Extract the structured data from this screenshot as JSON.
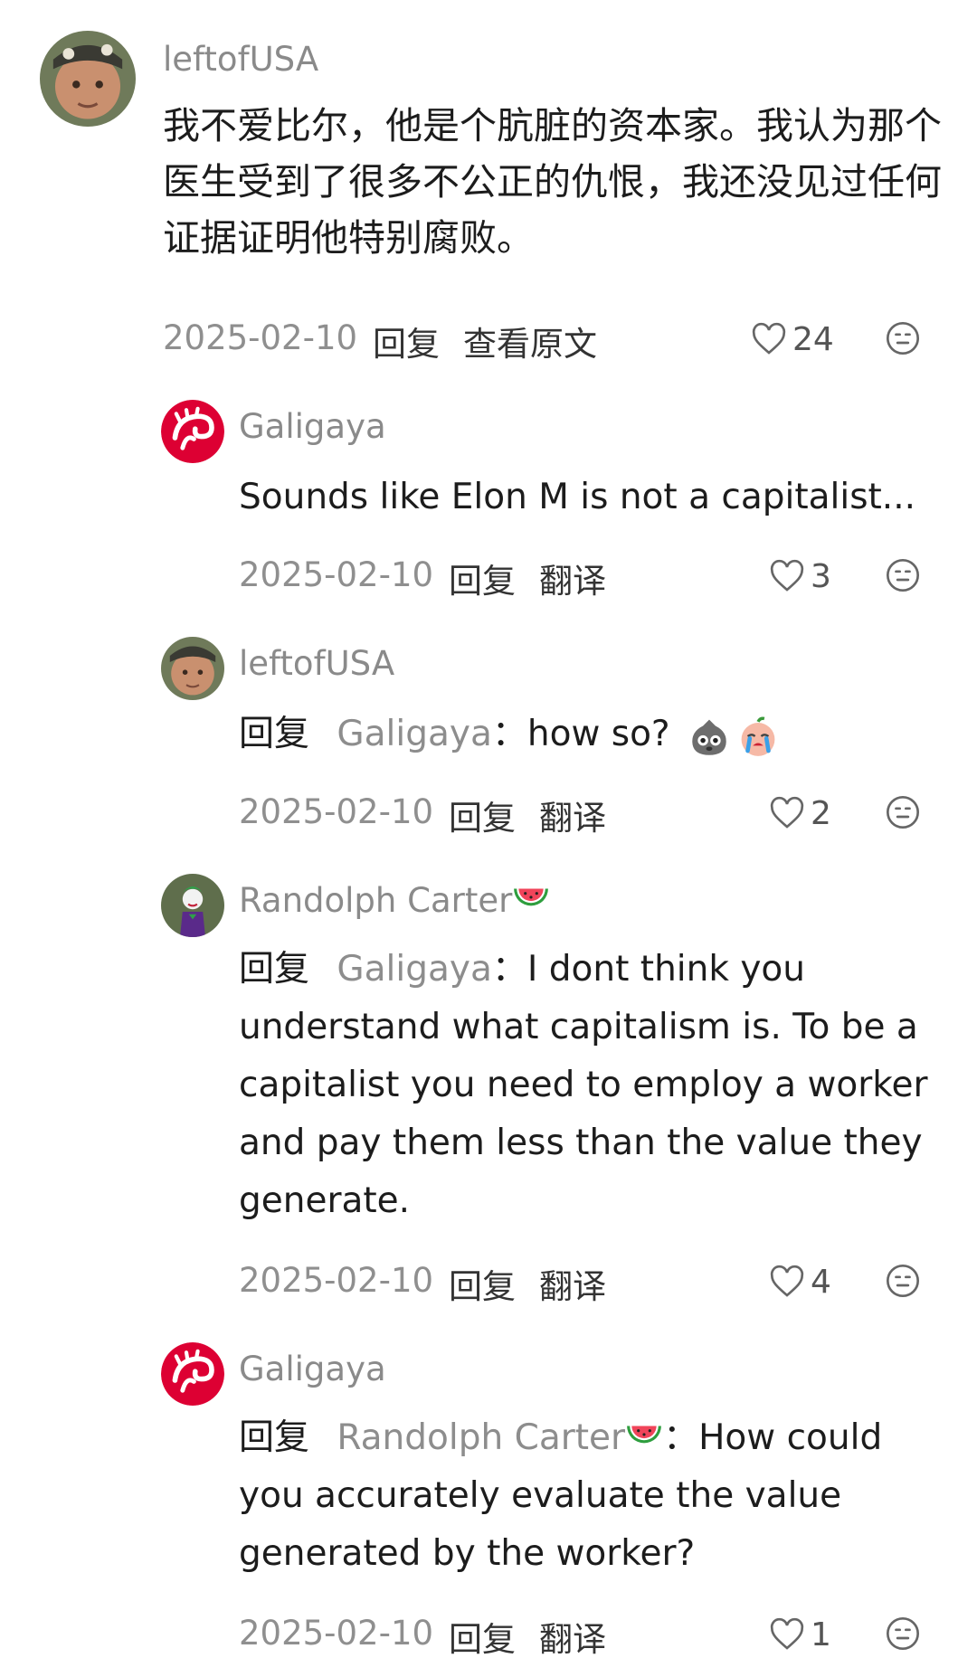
{
  "comments": [
    {
      "username": "leftofUSA",
      "text": "我不爱比尔，他是个肮脏的资本家。我认为那个医生受到了很多不公正的仇恨，我还没见过任何证据证明他特别腐败。",
      "lines": [
        "我不爱比尔，他是个肮脏的资本家。我认为那个",
        "医生受到了很多不公正的仇恨，我还没见过任何",
        "证据证明他特别腐败。"
      ],
      "date": "2025-02-10",
      "reply_label": "回复",
      "secondary_label": "查看原文",
      "likes": "24",
      "avatar_icon": "user-avatar-photo",
      "emoji_icon": "neutral-face-icon"
    },
    {
      "username": "Galigaya",
      "text": "Sounds like Elon M is not a capitalist...",
      "date": "2025-02-10",
      "reply_label": "回复",
      "secondary_label": "翻译",
      "likes": "3",
      "avatar_icon": "red-swirl-logo-avatar",
      "emoji_icon": "neutral-face-icon"
    },
    {
      "username": "leftofUSA",
      "reply_prefix": "回复",
      "reply_to": "Galigaya",
      "separator": "：",
      "text": "how so?",
      "inline_emojis": [
        "grey-sack-face-emoji",
        "crying-peach-face-emoji"
      ],
      "date": "2025-02-10",
      "reply_label": "回复",
      "secondary_label": "翻译",
      "likes": "2",
      "avatar_icon": "user-avatar-photo",
      "emoji_icon": "neutral-face-icon"
    },
    {
      "username": "Randolph Carter",
      "username_emoji": "watermelon-emoji",
      "reply_prefix": "回复",
      "reply_to": "Galigaya",
      "separator": "：",
      "lines": [
        "I dont think you",
        "understand what capitalism is. To be a",
        "capitalist you need to employ a worker",
        "and pay them less than the value they",
        "generate."
      ],
      "text": "I dont think you understand what capitalism is. To be a capitalist you need to employ a worker and pay them less than the value they generate.",
      "date": "2025-02-10",
      "reply_label": "回复",
      "secondary_label": "翻译",
      "likes": "4",
      "avatar_icon": "joker-character-avatar",
      "emoji_icon": "neutral-face-icon"
    },
    {
      "username": "Galigaya",
      "reply_prefix": "回复",
      "reply_to": "Randolph Carter",
      "reply_to_emoji": "watermelon-emoji",
      "separator": "：",
      "lines": [
        "How could",
        "you accurately evaluate the value",
        "generated by the worker?"
      ],
      "text": "How could you accurately evaluate the value generated by the worker?",
      "date": "2025-02-10",
      "reply_label": "回复",
      "secondary_label": "翻译",
      "likes": "1",
      "avatar_icon": "red-swirl-logo-avatar",
      "emoji_icon": "neutral-face-icon"
    }
  ],
  "colors": {
    "username": "#8a8a8a",
    "body": "#1c1c1c",
    "meta": "#8f8f8f",
    "brand_red": "#dd0033"
  }
}
